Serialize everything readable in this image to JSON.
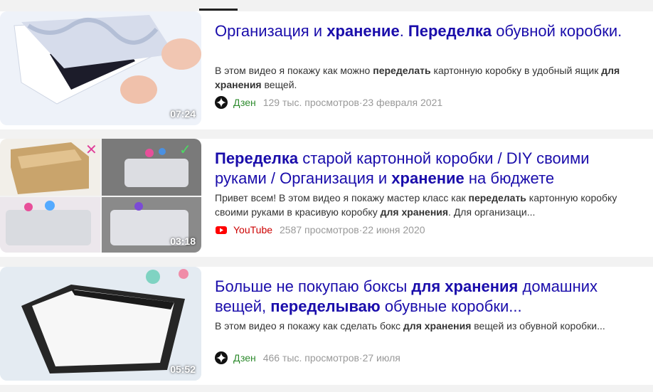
{
  "results": [
    {
      "title_parts": [
        {
          "t": "Организация и ",
          "b": false
        },
        {
          "t": "хранение",
          "b": true
        },
        {
          "t": ". ",
          "b": false
        },
        {
          "t": "Переделка",
          "b": true
        },
        {
          "t": " обувной коробки.",
          "b": false
        }
      ],
      "desc_parts": [
        {
          "t": "В этом видео я покажу как можно ",
          "b": false
        },
        {
          "t": "переделать",
          "b": true
        },
        {
          "t": " картонную коробку в удобный ящик ",
          "b": false
        },
        {
          "t": "для хранения",
          "b": true
        },
        {
          "t": " вещей.",
          "b": false
        }
      ],
      "source": "Дзен",
      "source_icon": "dzen-icon",
      "views": "129 тыс. просмотров",
      "date": "23 февраля 2021",
      "duration": "07:24"
    },
    {
      "title_parts": [
        {
          "t": "Переделка",
          "b": true
        },
        {
          "t": " старой картонной коробки / DIY своими руками / Организация и ",
          "b": false
        },
        {
          "t": "хранение",
          "b": true
        },
        {
          "t": " на бюджете",
          "b": false
        }
      ],
      "desc_parts": [
        {
          "t": "Привет всем! В этом видео я покажу мастер класс как ",
          "b": false
        },
        {
          "t": "переделать",
          "b": true
        },
        {
          "t": " картонную коробку своими руками в красивую коробку ",
          "b": false
        },
        {
          "t": "для хранения",
          "b": true
        },
        {
          "t": ". Для организаци...",
          "b": false
        }
      ],
      "source": "YouTube",
      "source_icon": "youtube-icon",
      "views": "2587 просмотров",
      "date": "22 июня 2020",
      "duration": "03:18"
    },
    {
      "title_parts": [
        {
          "t": "Больше не покупаю боксы ",
          "b": false
        },
        {
          "t": "для хранения",
          "b": true
        },
        {
          "t": " домашних вещей, ",
          "b": false
        },
        {
          "t": "переделываю",
          "b": true
        },
        {
          "t": " обувные коробки...",
          "b": false
        }
      ],
      "desc_parts": [
        {
          "t": "В этом видео я покажу как сделать бокс ",
          "b": false
        },
        {
          "t": "для хранения",
          "b": true
        },
        {
          "t": " вещей из обувной коробки...",
          "b": false
        }
      ],
      "source": "Дзен",
      "source_icon": "dzen-icon",
      "views": "466 тыс. просмотров",
      "date": "27 июля",
      "duration": "05:52"
    }
  ],
  "separator": " · ",
  "colors": {
    "title": "#1a0dab",
    "source_dzen": "#2e8b2e",
    "meta": "#999999"
  }
}
